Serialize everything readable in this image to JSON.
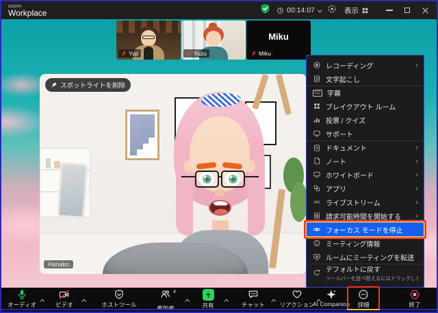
{
  "titlebar": {
    "logo_top": "zoom",
    "logo_bottom": "Workplace",
    "meeting_time": "00:14:07",
    "view_label": "表示"
  },
  "thumbnails": [
    {
      "name": "Yuji"
    },
    {
      "name": "Yuzu"
    },
    {
      "name": "Miku",
      "tile_label": "Miku"
    }
  ],
  "main_video": {
    "spotlight_label": "スポットライトを削除",
    "name_label": "Hanako"
  },
  "menu": {
    "items": [
      {
        "label": "レコーディング",
        "submenu": true
      },
      {
        "label": "文字起こし"
      },
      {
        "label": "字幕"
      },
      {
        "label": "ブレイクアウト ルーム"
      },
      {
        "label": "投票 / クイズ"
      },
      {
        "label": "サポート"
      },
      {
        "label": "ドキュメント",
        "submenu": true
      },
      {
        "label": "ノート",
        "submenu": true
      },
      {
        "label": "ホワイトボード",
        "submenu": true
      },
      {
        "label": "アプリ",
        "submenu": true
      },
      {
        "label": "ライブストリーム",
        "submenu": true
      },
      {
        "label": "請求可能時間を開始する",
        "submenu": true
      },
      {
        "label": "フォーカス モードを停止",
        "highlighted": true
      },
      {
        "label": "ミーティング情報"
      },
      {
        "label": "ルームにミーティングを転送"
      },
      {
        "label": "デフォルトに戻す",
        "sublabel": "ツールバーを並べ替えるにはドラッグします"
      }
    ]
  },
  "toolbar": {
    "audio_label": "オーディオ",
    "video_label": "ビデオ",
    "host_tools_label": "ホストツール",
    "participants_label": "参加者",
    "participants_badge": "4",
    "share_label": "共有",
    "chat_label": "チャット",
    "reactions_label": "リアクション",
    "ai_companion_label": "AI Companion",
    "more_label": "詳細",
    "end_label": "終了"
  },
  "glyphs": {
    "submenu_arrow": "›",
    "cc": "CC"
  },
  "colors": {
    "accent_blue": "#1560f0",
    "menu_border_blue": "#2f49d1",
    "window_border_blue": "#2a2ab4",
    "annotation_red": "#f23428",
    "annotation_yellow": "#ffd24a",
    "share_green": "#23d959",
    "mic_green": "#22c55e",
    "end_red": "#ef3c4e",
    "security_green": "#1da35a"
  }
}
